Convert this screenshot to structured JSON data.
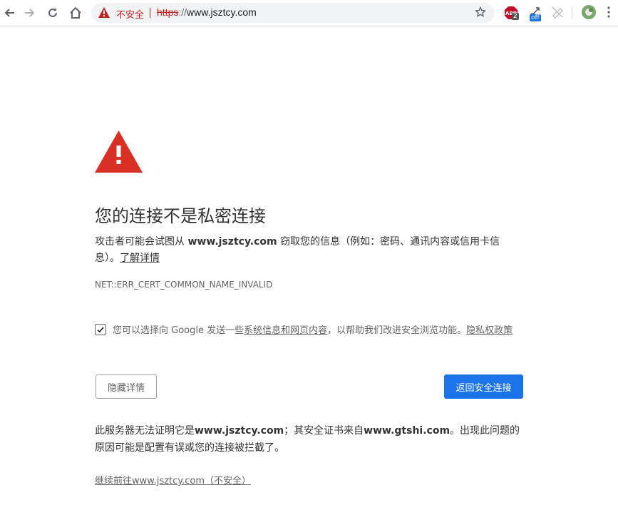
{
  "toolbar": {
    "security_label": "不安全",
    "url_scheme": "https",
    "url_rest": "://",
    "url_host": "www.jsztcy.com",
    "extensions": [
      {
        "name": "abp-icon",
        "badge": "2"
      },
      {
        "name": "proxy-off-icon",
        "badge": "off"
      }
    ]
  },
  "main": {
    "title": "您的连接不是私密连接",
    "desc_pre": "攻击者可能会试图从 ",
    "desc_host": "www.jsztcy.com",
    "desc_post": " 窃取您的信息（例如：密码、通讯内容或信用卡信息）。",
    "learn_more": "了解详情",
    "error_code": "NET::ERR_CERT_COMMON_NAME_INVALID",
    "opt_in_pre": "您可以选择向 Google 发送一些",
    "opt_in_link": "系统信息和网页内容",
    "opt_in_post": "，以帮助我们改进安全浏览功能。",
    "privacy_link": "隐私权政策",
    "details_button": "隐藏详情",
    "back_button": "返回安全连接",
    "details_pre": "此服务器无法证明它是",
    "details_host": "www.jsztcy.com",
    "details_mid": "；其安全证书来自",
    "details_issuer": "www.gtshi.com",
    "details_post": "。出现此问题的原因可能是配置有误或您的连接被拦截了。",
    "proceed_link": "继续前往www.jsztcy.com（不安全）"
  },
  "colors": {
    "warning_red": "#d93025",
    "primary_blue": "#1a73e8"
  }
}
